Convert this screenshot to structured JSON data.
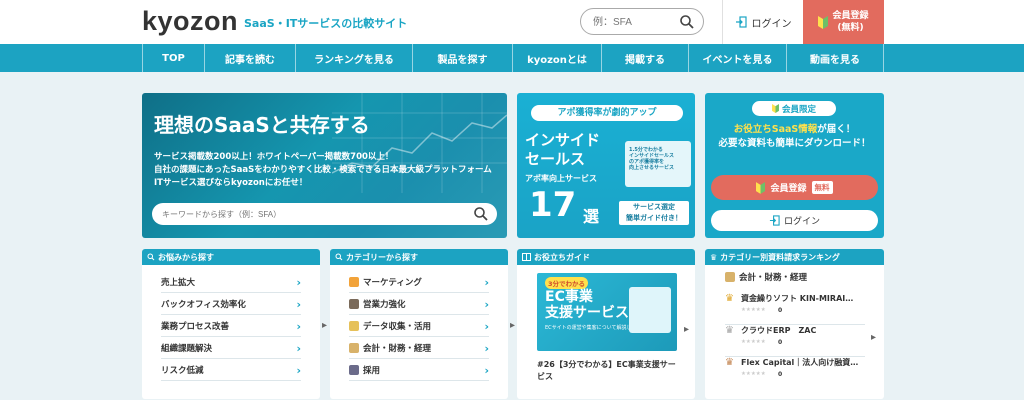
{
  "header": {
    "logo": "kyozon",
    "tagline": "SaaS・ITサービスの比較サイト",
    "search_placeholder": "例：SFA",
    "login_label": "ログイン",
    "register_label": "会員登録",
    "register_sub": "(無料)"
  },
  "nav": {
    "items": [
      {
        "label": "TOP"
      },
      {
        "label": "記事を読む"
      },
      {
        "label": "ランキングを見る"
      },
      {
        "label": "製品を探す"
      },
      {
        "label": "kyozonとは"
      },
      {
        "label": "掲載する"
      },
      {
        "label": "イベントを見る"
      },
      {
        "label": "動画を見る"
      }
    ]
  },
  "hero": {
    "title": "理想のSaaSと共存する",
    "line1": "サービス掲載数200以上！ホワイトペーパー掲載数700以上！",
    "line2": "自社の課題にあったSaaSをわかりやすく比較・検索できる日本最大級プラットフォーム",
    "line3": "ITサービス選びならkyozonにお任せ！",
    "search_placeholder": "キーワードから探す（例：SFA）"
  },
  "banner": {
    "pill": "アポ獲得率が劇的アップ",
    "main1": "インサイド",
    "main2": "セールス",
    "sub": "アポ率向上サービス",
    "num": "17",
    "sen": "選",
    "img_text1": "1.5分でわかる",
    "img_text2": "インサイドセールス",
    "img_text3": "のアポ獲得率を",
    "img_text4": "向上させるサービス",
    "tag1": "サービス選定",
    "tag2": "簡単ガイド付き！"
  },
  "member": {
    "pill": "会員限定",
    "line1_hl": "お役立ちSaaS情報",
    "line1_rest": "が届く！",
    "line2": "必要な資料も簡単にダウンロード！",
    "register_label": "会員登録",
    "free_label": "無料",
    "login_label": "ログイン"
  },
  "cards": {
    "problems": {
      "title": "お悩みから探す",
      "items": [
        {
          "label": "売上拡大"
        },
        {
          "label": "バックオフィス効率化"
        },
        {
          "label": "業務プロセス改善"
        },
        {
          "label": "組織課題解決"
        },
        {
          "label": "リスク低減"
        }
      ]
    },
    "categories": {
      "title": "カテゴリーから探す",
      "items": [
        {
          "label": "マーケティング",
          "color": "#f2a33a"
        },
        {
          "label": "営業力強化",
          "color": "#7a6a5a"
        },
        {
          "label": "データ収集・活用",
          "color": "#e6c15a"
        },
        {
          "label": "会計・財務・経理",
          "color": "#d8b26a"
        },
        {
          "label": "採用",
          "color": "#6b6b8a"
        }
      ]
    },
    "guide": {
      "title": "お役立ちガイド",
      "img_badge": "3分でわかる",
      "img_big1": "EC事業",
      "img_big2": "支援サービス",
      "img_small": "ECサイトの運営や集客について解説します",
      "article_title": "#26【3分でわかる】EC事業支援サービス"
    },
    "ranking": {
      "title": "カテゴリー別資料請求ランキング",
      "category": "会計・財務・経理",
      "items": [
        {
          "name": "資金繰りソフト KIN-MIRAI…",
          "count": "0",
          "crown_color": "#e0a82e"
        },
        {
          "name": "クラウドERP　ZAC",
          "count": "0",
          "crown_color": "#a5a5a5"
        },
        {
          "name": "Flex Capital｜法人向け融資…",
          "count": "0",
          "crown_color": "#c48755"
        }
      ]
    }
  },
  "colors": {
    "brand": "#1ca3c2",
    "accent": "#e26b5e",
    "highlight": "#ffe14d"
  }
}
